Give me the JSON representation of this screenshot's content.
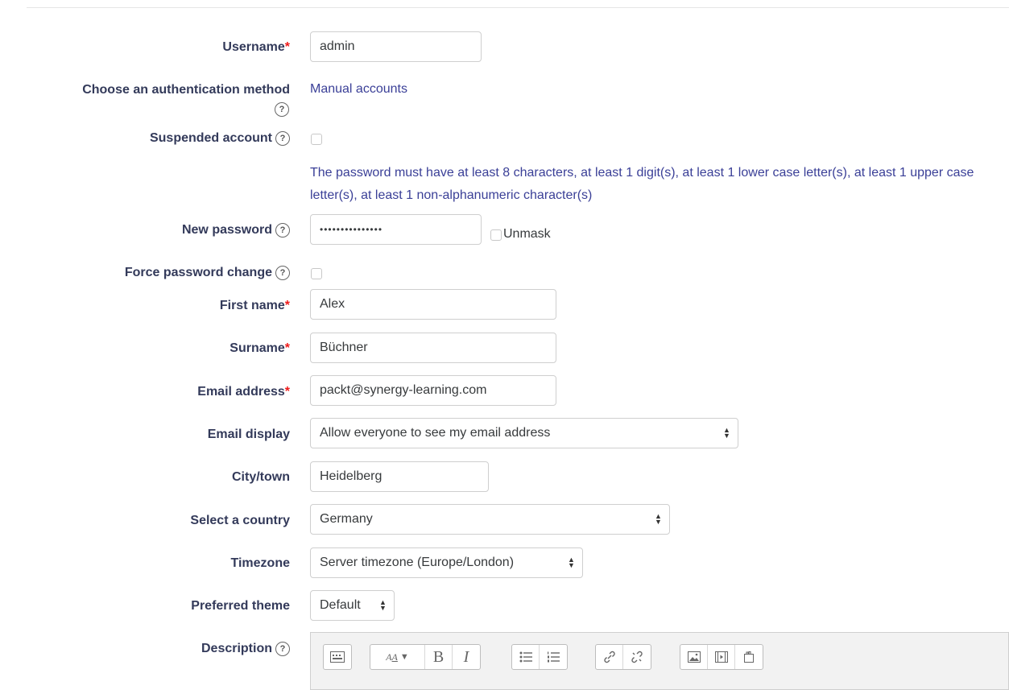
{
  "form": {
    "username": {
      "label": "Username",
      "required": "*",
      "value": "admin"
    },
    "auth": {
      "label": "Choose an authentication method",
      "value": "Manual accounts"
    },
    "suspended": {
      "label": "Suspended account"
    },
    "password_policy": "The password must have at least 8 characters, at least 1 digit(s), at least 1 lower case letter(s), at least 1 upper case letter(s), at least 1 non-alphanumeric character(s)",
    "new_password": {
      "label": "New password",
      "value": "•••••••••••••••",
      "unmask_label": "Unmask"
    },
    "force_change": {
      "label": "Force password change"
    },
    "first_name": {
      "label": "First name",
      "required": "*",
      "value": "Alex"
    },
    "surname": {
      "label": "Surname",
      "required": "*",
      "value": "Büchner"
    },
    "email": {
      "label": "Email address",
      "required": "*",
      "value": "packt@synergy-learning.com"
    },
    "email_display": {
      "label": "Email display",
      "value": "Allow everyone to see my email address"
    },
    "city": {
      "label": "City/town",
      "value": "Heidelberg"
    },
    "country": {
      "label": "Select a country",
      "value": "Germany"
    },
    "timezone": {
      "label": "Timezone",
      "value": "Server timezone (Europe/London)"
    },
    "theme": {
      "label": "Preferred theme",
      "value": "Default"
    },
    "description": {
      "label": "Description"
    }
  },
  "help_glyph": "?",
  "editor_toolbar": {
    "groups": [
      [
        "show-more-icon"
      ],
      [
        "font-style-icon",
        "bold-icon",
        "italic-icon"
      ],
      [
        "bullet-list-icon",
        "numbered-list-icon"
      ],
      [
        "link-icon",
        "unlink-icon"
      ],
      [
        "image-icon",
        "media-icon",
        "manage-files-icon"
      ]
    ],
    "bold_glyph": "B",
    "italic_glyph": "I"
  },
  "colors": {
    "label": "#333a5a",
    "required": "#ef1b1b",
    "link": "#3a3f97"
  }
}
